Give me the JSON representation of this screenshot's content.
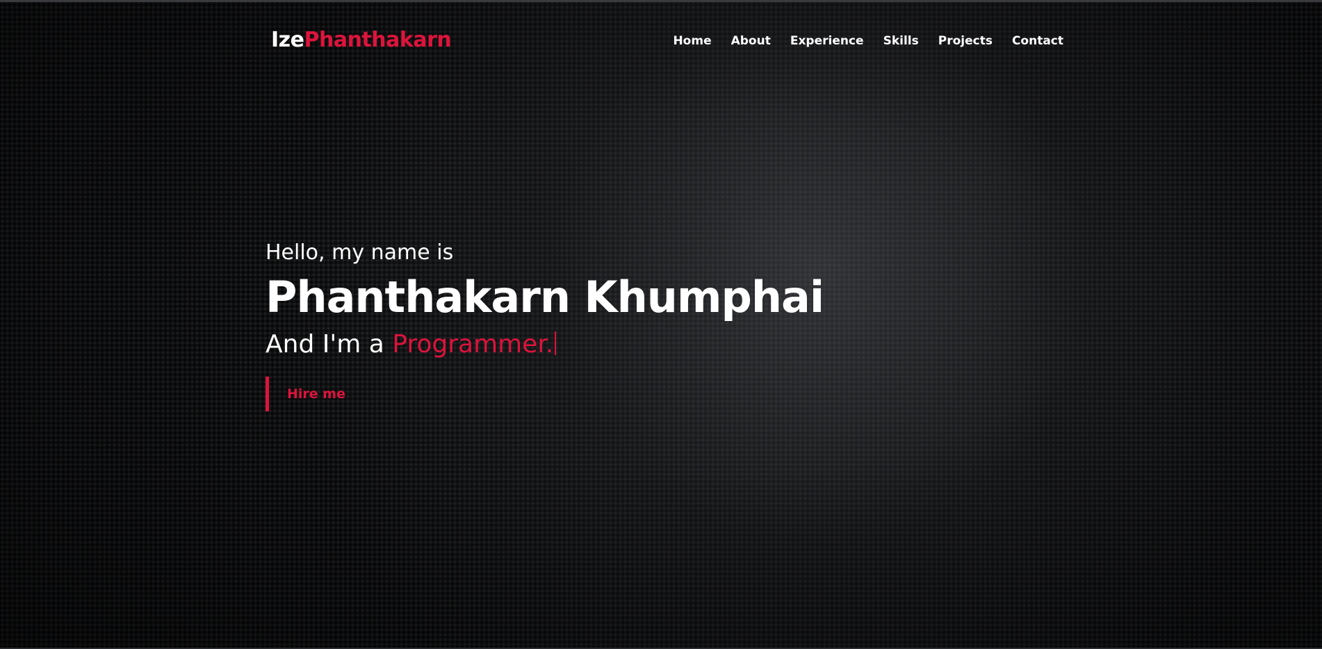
{
  "brand": {
    "first": "Ize",
    "second": "Phanthakarn"
  },
  "nav": {
    "items": [
      {
        "label": "Home"
      },
      {
        "label": "About"
      },
      {
        "label": "Experience"
      },
      {
        "label": "Skills"
      },
      {
        "label": "Projects"
      },
      {
        "label": "Contact"
      }
    ]
  },
  "hero": {
    "greeting": "Hello, my name is",
    "name": "Phanthakarn Khumphai",
    "role_prefix": "And I'm a ",
    "role": "Programmer.",
    "cta_label": "Hire me"
  },
  "colors": {
    "accent": "#dc143c",
    "text": "#ffffff",
    "background": "#111214"
  }
}
